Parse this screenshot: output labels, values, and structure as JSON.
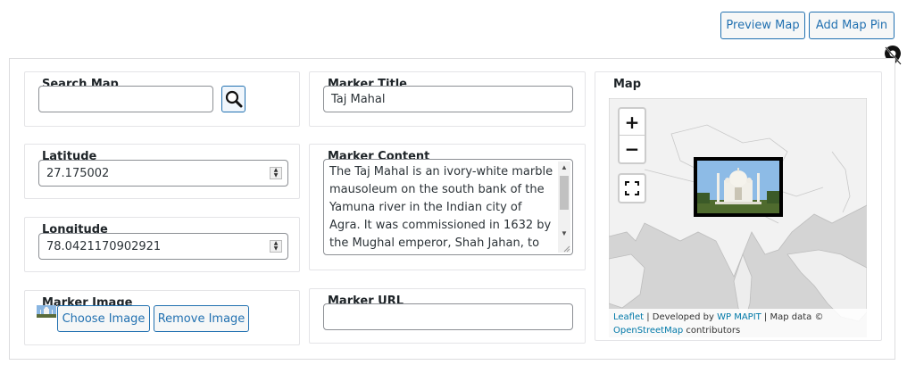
{
  "toolbar": {
    "preview_label": "Preview Map",
    "add_pin_label": "Add Map Pin"
  },
  "search": {
    "label": "Search Map",
    "value": "",
    "placeholder": ""
  },
  "latitude": {
    "label": "Latitude",
    "value": "27.175002"
  },
  "longitude": {
    "label": "Longitude",
    "value": "78.0421170902921"
  },
  "marker_image": {
    "label": "Marker Image",
    "choose_label": "Choose Image",
    "remove_label": "Remove Image"
  },
  "marker_title": {
    "label": "Marker Title",
    "value": "Taj Mahal"
  },
  "marker_content": {
    "label": "Marker Content",
    "value": "The Taj Mahal is an ivory-white marble mausoleum on the south bank of the Yamuna river in the Indian city of Agra. It was commissioned in 1632 by the Mughal emperor, Shah Jahan, to house"
  },
  "marker_url": {
    "label": "Marker URL",
    "value": ""
  },
  "map": {
    "label": "Map",
    "zoom_in": "+",
    "zoom_out": "−",
    "attribution": {
      "leaflet": "Leaflet",
      "sep1": " | Developed by ",
      "wpmapit": "WP MAPIT",
      "sep2": " | Map data © ",
      "osm": "OpenStreetMap",
      "contributors": " contributors"
    }
  },
  "colors": {
    "accent": "#2271b1",
    "link": "#0078a8",
    "border": "#dcdcde"
  }
}
